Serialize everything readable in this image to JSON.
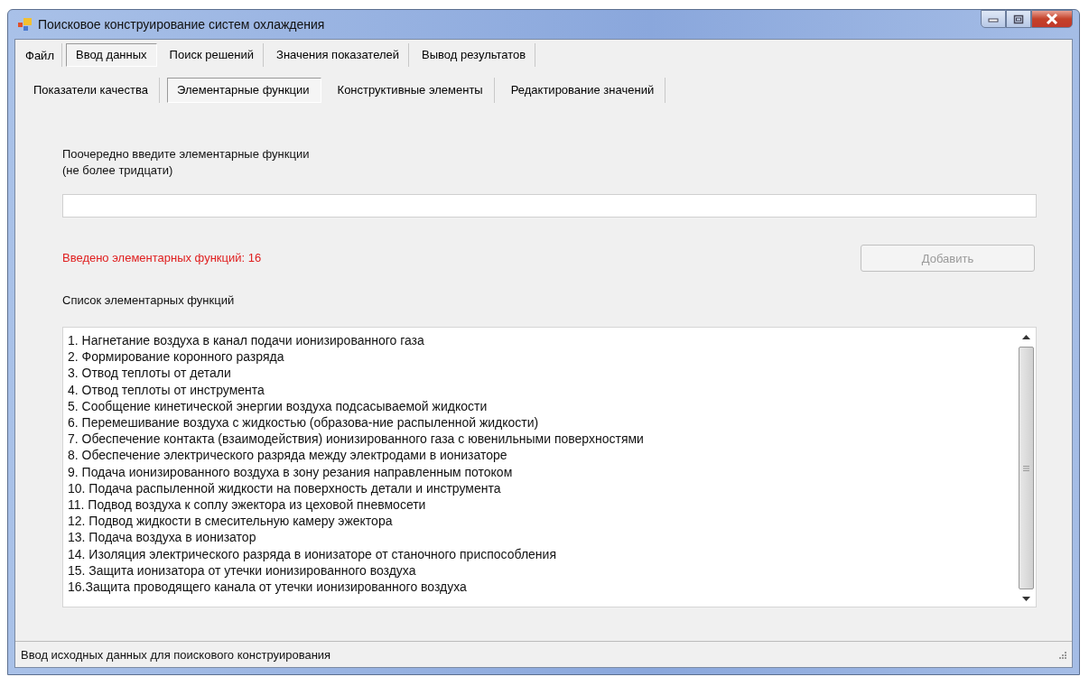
{
  "window": {
    "title": "Поисковое конструирование систем охлаждения"
  },
  "menu": [
    {
      "label": "Файл",
      "kind": "plain",
      "selected": false
    },
    {
      "label": "Ввод данных",
      "kind": "tab",
      "selected": true
    },
    {
      "label": "Поиск решений",
      "kind": "tab",
      "selected": false
    },
    {
      "label": "Значения показателей",
      "kind": "tab",
      "selected": false
    },
    {
      "label": "Вывод результатов",
      "kind": "tab",
      "selected": false
    }
  ],
  "subtabs": [
    {
      "label": "Показатели качества",
      "selected": false
    },
    {
      "label": "Элементарные функции",
      "selected": true
    },
    {
      "label": "Конструктивные элементы",
      "selected": false
    },
    {
      "label": "Редактирование значений",
      "selected": false
    }
  ],
  "prompt": {
    "line_1": "Поочередно введите элементарные функции",
    "line_2": "(не более тридцати)"
  },
  "count_label": "Введено элементарных функций: 16",
  "add_button": {
    "label": "Добавить",
    "disabled": true
  },
  "list_label": "Список элементарных функций",
  "list_items": [
    "1. Нагнетание воздуха в канал подачи ионизированного газа",
    "2. Формирование коронного разряда",
    "3. Отвод теплоты от детали",
    "4. Отвод теплоты от инструмента",
    "5. Сообщение кинетической энергии воздуха подсасываемой жидкости",
    "6. Перемешивание воздуха с жидкостью (образова-ние распыленной жидкости)",
    "7. Обеспечение контакта (взаимодействия) ионизированного газа с ювенильными поверхностями",
    "8. Обеспечение электрического разряда между электродами в ионизаторе",
    "9. Подача ионизированного воздуха в зону резания направленным потоком",
    "10. Подача распыленной жидкости на поверхность детали и инструмента",
    "11. Подвод воздуха к соплу эжектора из цеховой пневмосети",
    "12. Подвод жидкости в смесительную камеру эжектора",
    "13. Подача воздуха в ионизатор",
    "14. Изоляция электрического разряда в ионизаторе от станочного приспособления",
    "15. Защита ионизатора от утечки ионизированного воздуха",
    "16.Защита проводящего канала от утечки ионизированного воздуха"
  ],
  "status_bar": "Ввод исходных данных для поискового конструирования"
}
